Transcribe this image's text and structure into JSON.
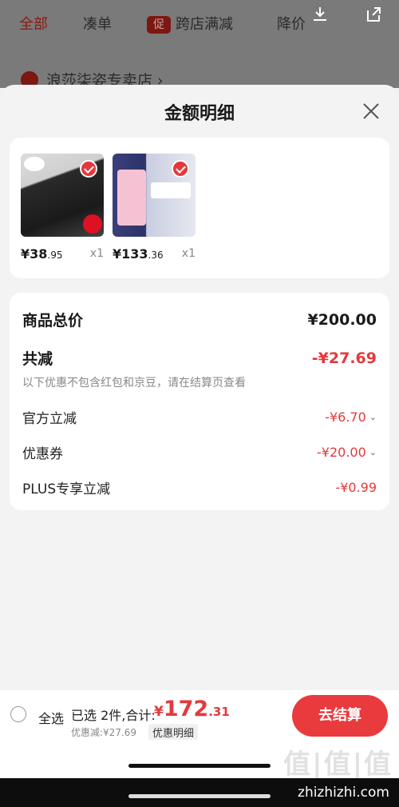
{
  "background": {
    "tabs": [
      "全部",
      "凑单",
      "跨店满减",
      "降价"
    ],
    "promo_tag": "促",
    "store_name": "浪莎柒姿专卖店 ›"
  },
  "sheet": {
    "title": "金额明细",
    "products": [
      {
        "price_main": "¥38",
        "price_dec": ".95",
        "qty": "x1"
      },
      {
        "price_main": "¥133",
        "price_dec": ".36",
        "qty": "x1"
      }
    ],
    "summary": {
      "goods_total_label": "商品总价",
      "goods_total_value": "¥200.00",
      "total_reduce_label": "共减",
      "total_reduce_value": "-¥27.69",
      "note": "以下优惠不包含红包和京豆，请在结算页查看",
      "items": [
        {
          "label": "官方立减",
          "value": "-¥6.70",
          "has_chevron": true
        },
        {
          "label": "优惠券",
          "value": "-¥20.00",
          "has_chevron": true
        },
        {
          "label": "PLUS专享立减",
          "value": "-¥0.99",
          "has_chevron": false
        }
      ]
    }
  },
  "bottom_bar": {
    "select_all": "全选",
    "selected_text": "已选 2件,合计:",
    "total_currency": "¥",
    "total_int": "172",
    "total_dec": ".31",
    "discount_text": "优惠减:¥27.69",
    "detail_link": "优惠明细",
    "checkout": "去结算"
  },
  "watermark": {
    "logo": "值|值|值",
    "site": "zhizhizhi.com"
  },
  "colors": {
    "accent": "#e4393c",
    "dim_bg": "#7a7a7a"
  }
}
